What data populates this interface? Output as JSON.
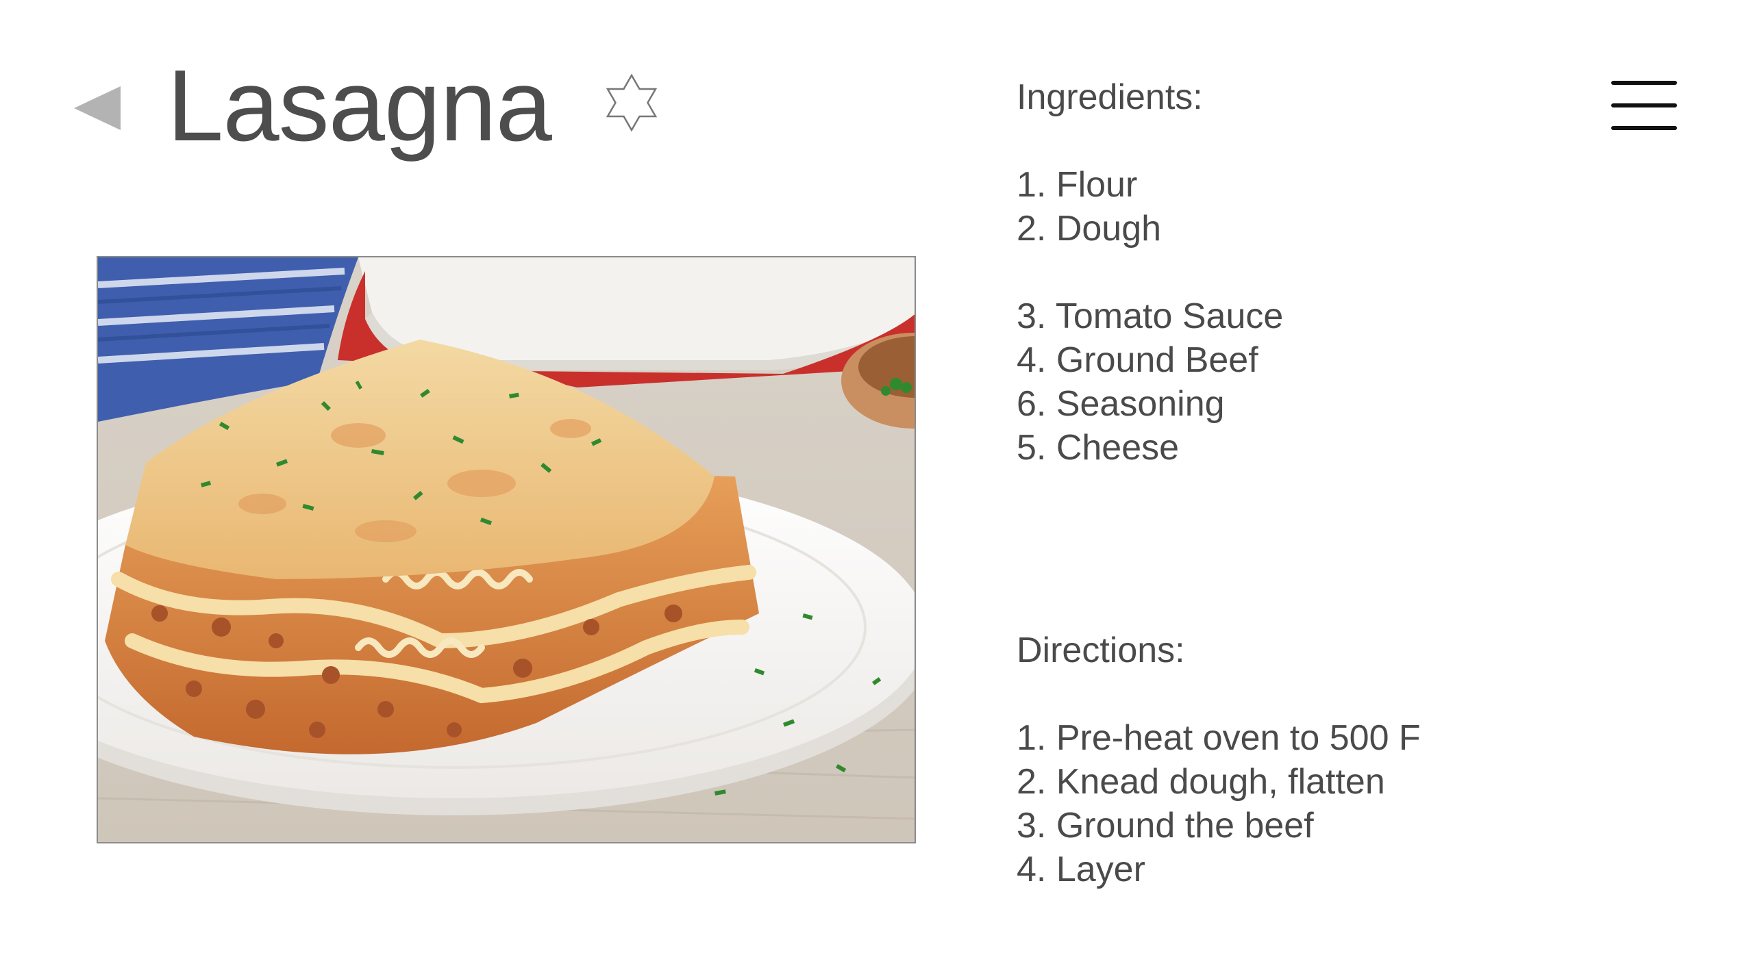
{
  "header": {
    "title": "Lasagna",
    "back_icon": "back-triangle-icon",
    "favorite_icon": "star-of-david-outline-icon",
    "menu_icon": "hamburger-menu-icon"
  },
  "photo": {
    "subject": "lasagna-photo"
  },
  "ingredients": {
    "heading": "Ingredients:",
    "items": [
      "1. Flour",
      "2. Dough",
      "3. Tomato Sauce",
      "4. Ground Beef",
      "6. Seasoning",
      "5. Cheese"
    ]
  },
  "directions": {
    "heading": "Directions:",
    "items": [
      "1. Pre-heat oven to 500 F",
      "2. Knead dough, flatten",
      "3. Ground the beef",
      "4. Layer"
    ]
  },
  "colors": {
    "title_text": "#4d4d4d",
    "body_text": "#4a4a4a",
    "back_icon": "#b3b3b3",
    "menu_icon": "#111111",
    "photo_border": "#8a8a8a"
  }
}
